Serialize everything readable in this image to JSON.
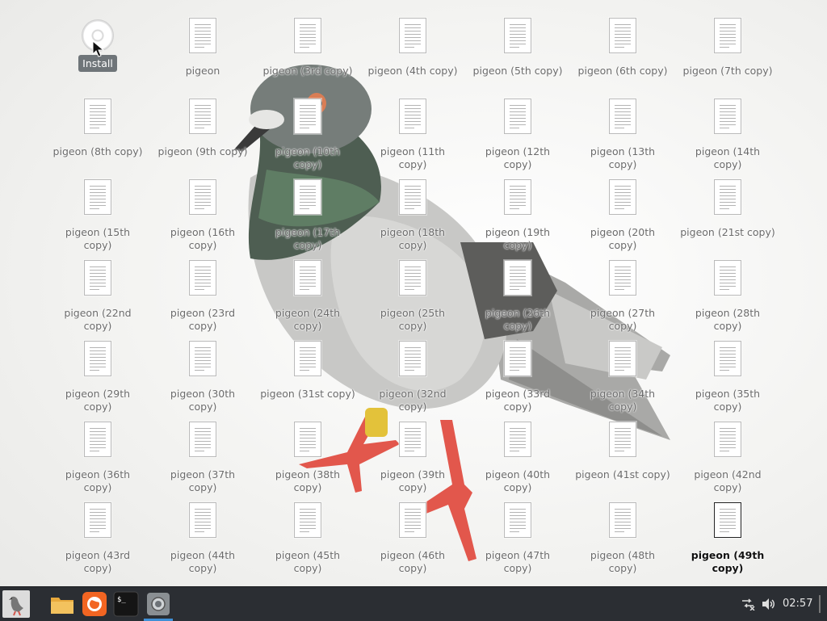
{
  "desktop": {
    "install_label": "Install",
    "icons": [
      {
        "label": "pigeon (8th copy)"
      },
      {
        "label": "pigeon (15th copy)"
      },
      {
        "label": "pigeon (22nd copy)"
      },
      {
        "label": "pigeon (29th copy)"
      },
      {
        "label": "pigeon (36th copy)"
      },
      {
        "label": "pigeon (43rd copy)"
      },
      {
        "label": "pigeon"
      },
      {
        "label": "pigeon (9th copy)"
      },
      {
        "label": "pigeon (16th copy)"
      },
      {
        "label": "pigeon (23rd copy)"
      },
      {
        "label": "pigeon (30th copy)"
      },
      {
        "label": "pigeon (37th copy)"
      },
      {
        "label": "pigeon (44th copy)"
      },
      {
        "label": "pigeon (3rd copy)"
      },
      {
        "label": "pigeon (10th copy)"
      },
      {
        "label": "pigeon (17th copy)"
      },
      {
        "label": "pigeon (24th copy)"
      },
      {
        "label": "pigeon (31st copy)"
      },
      {
        "label": "pigeon (38th copy)"
      },
      {
        "label": "pigeon (45th copy)"
      },
      {
        "label": "pigeon (4th copy)"
      },
      {
        "label": "pigeon (11th copy)"
      },
      {
        "label": "pigeon (18th copy)"
      },
      {
        "label": "pigeon (25th copy)"
      },
      {
        "label": "pigeon (32nd copy)"
      },
      {
        "label": "pigeon (39th copy)"
      },
      {
        "label": "pigeon (46th copy)"
      },
      {
        "label": "pigeon (5th copy)"
      },
      {
        "label": "pigeon (12th copy)"
      },
      {
        "label": "pigeon (19th copy)"
      },
      {
        "label": "pigeon (26th copy)"
      },
      {
        "label": "pigeon (33rd copy)"
      },
      {
        "label": "pigeon (40th copy)"
      },
      {
        "label": "pigeon (47th copy)"
      },
      {
        "label": "pigeon (6th copy)"
      },
      {
        "label": "pigeon (13th copy)"
      },
      {
        "label": "pigeon (20th copy)"
      },
      {
        "label": "pigeon (27th copy)"
      },
      {
        "label": "pigeon (34th copy)"
      },
      {
        "label": "pigeon (41st copy)"
      },
      {
        "label": "pigeon (48th copy)"
      },
      {
        "label": "pigeon (7th copy)"
      },
      {
        "label": "pigeon (14th copy)"
      },
      {
        "label": "pigeon (21st copy)"
      },
      {
        "label": "pigeon (28th copy)"
      },
      {
        "label": "pigeon (35th copy)"
      },
      {
        "label": "pigeon (42nd copy)"
      },
      {
        "label": "pigeon (49th copy)",
        "selected": true
      }
    ]
  },
  "taskbar": {
    "clock": "02:57",
    "launchers": [
      "file-manager-icon",
      "firefox-icon",
      "terminal-icon",
      "screenshot-icon"
    ],
    "tray": [
      "network-disconnected-icon",
      "volume-icon"
    ]
  },
  "colors": {
    "taskbar_bg": "#2b2e33",
    "active_indicator": "#3f8fd6",
    "folder": "#f0b64a",
    "firefox": "#f26522"
  }
}
